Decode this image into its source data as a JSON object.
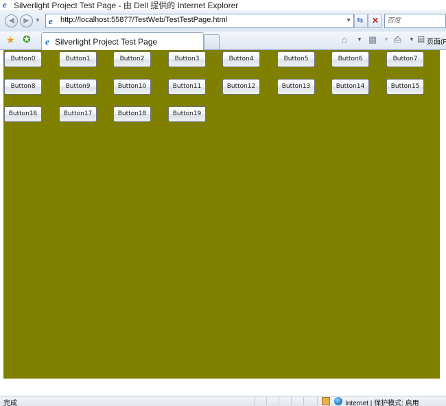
{
  "window": {
    "title": "Silverlight Project Test Page - 由 Dell 提供的 Internet Explorer"
  },
  "address_bar": {
    "url": "http://localhost:55877/TestWeb/TestTestPage.html"
  },
  "search": {
    "placeholder": "百度"
  },
  "tab": {
    "label": "Silverlight Project Test Page"
  },
  "command_bar": {
    "page_label": "页面(P"
  },
  "colors": {
    "canvas_background": "#808000",
    "ie_blue": "#1a62c2"
  },
  "buttons": [
    {
      "label": "Button0"
    },
    {
      "label": "Button1"
    },
    {
      "label": "Button2"
    },
    {
      "label": "Button3"
    },
    {
      "label": "Button4"
    },
    {
      "label": "Button5"
    },
    {
      "label": "Button6"
    },
    {
      "label": "Button7"
    },
    {
      "label": "Button8"
    },
    {
      "label": "Button9"
    },
    {
      "label": "Button10"
    },
    {
      "label": "Button11"
    },
    {
      "label": "Button12"
    },
    {
      "label": "Button13"
    },
    {
      "label": "Button14"
    },
    {
      "label": "Button15"
    },
    {
      "label": "Button16"
    },
    {
      "label": "Button17"
    },
    {
      "label": "Button18"
    },
    {
      "label": "Button19"
    }
  ],
  "status_bar": {
    "status": "完成",
    "zone": "Internet | 保护模式: 启用"
  }
}
